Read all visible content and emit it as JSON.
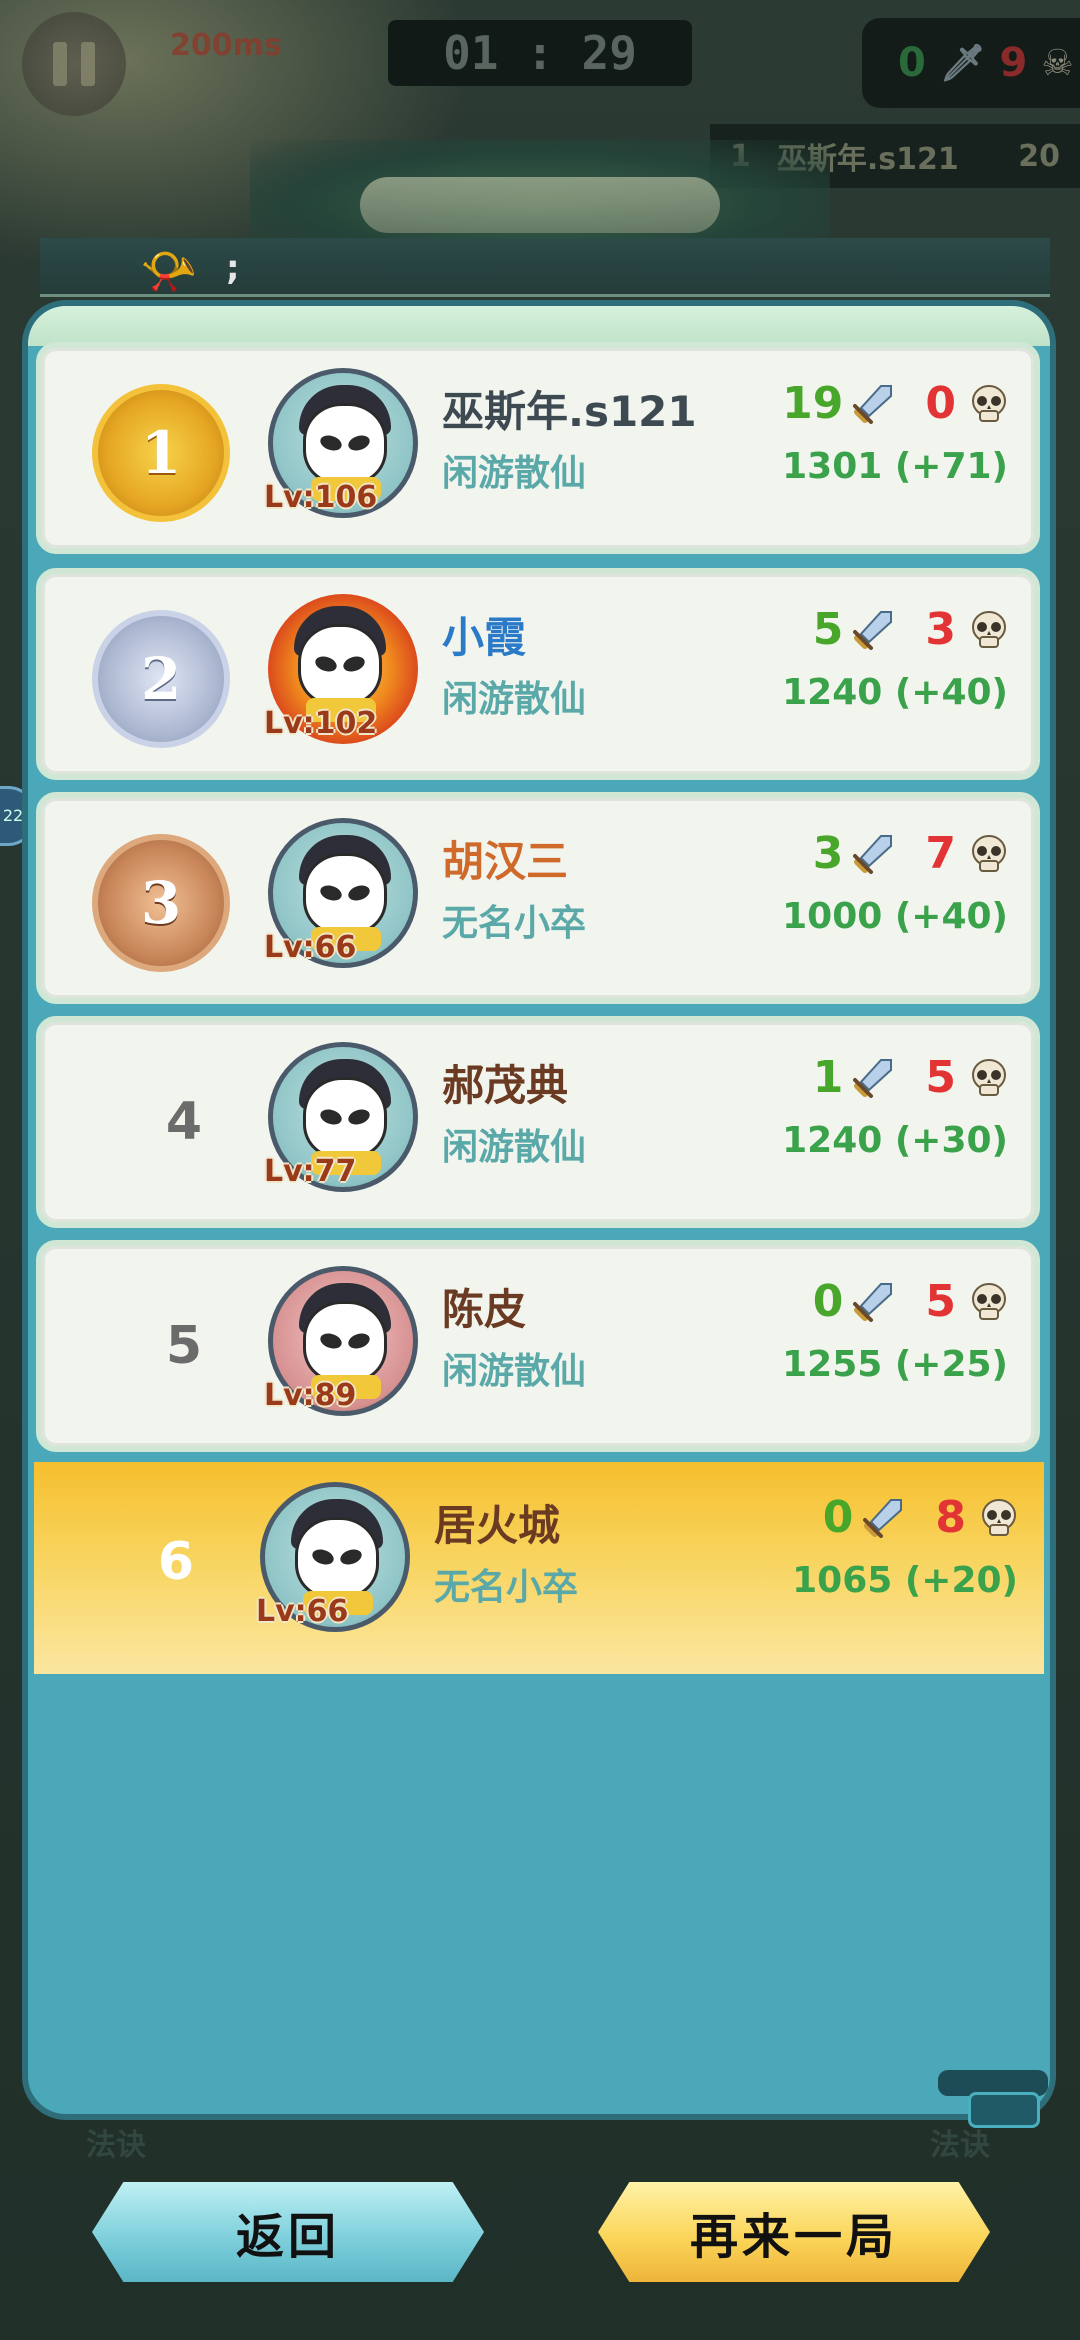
{
  "hud": {
    "ping": "200ms",
    "timer": "01 : 29",
    "kills": "0",
    "deaths": "9",
    "top_rank_no": "1",
    "top_rank_name": "巫斯年.s121",
    "top_rank_score": "20"
  },
  "side_badge": "22",
  "players": [
    {
      "rank": "1",
      "medal": "gold",
      "name": "巫斯年.s121",
      "title": "闲游散仙",
      "level": "Lv:106",
      "kills": "19",
      "deaths": "0",
      "score": "1301 (+71)"
    },
    {
      "rank": "2",
      "medal": "silver",
      "name": "小霞",
      "title": "闲游散仙",
      "level": "Lv:102",
      "kills": "5",
      "deaths": "3",
      "score": "1240 (+40)"
    },
    {
      "rank": "3",
      "medal": "bronze",
      "name": "胡汉三",
      "title": "无名小卒",
      "level": "Lv:66",
      "kills": "3",
      "deaths": "7",
      "score": "1000 (+40)"
    },
    {
      "rank": "4",
      "name": "郝茂典",
      "title": "闲游散仙",
      "level": "Lv:77",
      "kills": "1",
      "deaths": "5",
      "score": "1240 (+30)"
    },
    {
      "rank": "5",
      "name": "陈皮",
      "title": "闲游散仙",
      "level": "Lv:89",
      "kills": "0",
      "deaths": "5",
      "score": "1255 (+25)"
    },
    {
      "rank": "6",
      "name": "居火城",
      "title": "无名小卒",
      "level": "Lv:66",
      "kills": "0",
      "deaths": "8",
      "score": "1065 (+20)",
      "is_self": true
    }
  ],
  "buttons": {
    "back": "返回",
    "again": "再来一局"
  },
  "side_labels": {
    "left": "法诀",
    "right": "法诀"
  },
  "chat": {
    "text": ";"
  },
  "colors": {
    "kills": "#48a62a",
    "deaths": "#e23434",
    "score": "#3aa24a",
    "self_row": "#f8d45e"
  }
}
